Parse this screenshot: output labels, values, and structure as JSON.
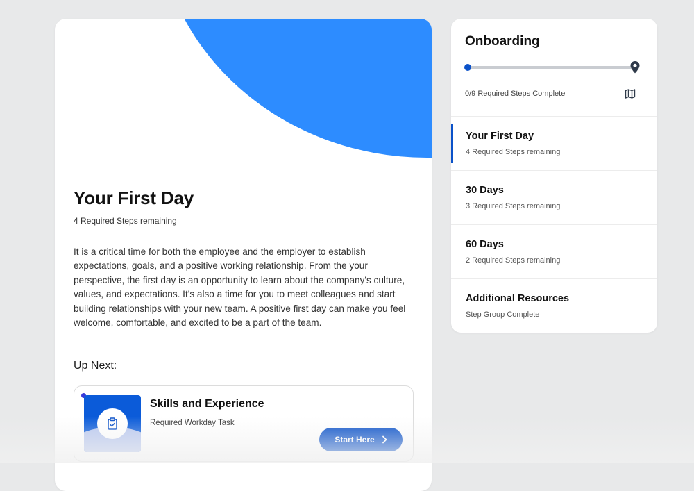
{
  "main": {
    "title": "Your First Day",
    "subtitle": "4 Required Steps remaining",
    "description": "It is a critical time for both the employee and the employer to establish expectations, goals, and a positive working relationship. From the your perspective, the first day is an opportunity to learn about the company's culture, values, and expectations. It's also a time for you to meet colleagues and start building relationships with your new team. A positive first day can make you feel welcome, comfortable, and excited to be a part of the team.",
    "up_next_label": "Up Next:",
    "task": {
      "title": "Skills and Experience",
      "subtitle": "Required Workday Task",
      "button_label": "Start Here",
      "icon": "clipboard-check-icon"
    }
  },
  "side": {
    "title": "Onboarding",
    "progress_text": "0/9 Required Steps Complete",
    "progress_fraction": 0,
    "groups": [
      {
        "name": "Your First Day",
        "remaining": "4 Required Steps remaining",
        "active": true
      },
      {
        "name": "30 Days",
        "remaining": "3 Required Steps remaining",
        "active": false
      },
      {
        "name": "60 Days",
        "remaining": "2 Required Steps remaining",
        "active": false
      },
      {
        "name": "Additional Resources",
        "remaining": "Step Group Complete",
        "active": false
      }
    ]
  },
  "colors": {
    "accent": "#0b52c9",
    "hero": "#2d8cff",
    "background": "#e8e9ea"
  }
}
